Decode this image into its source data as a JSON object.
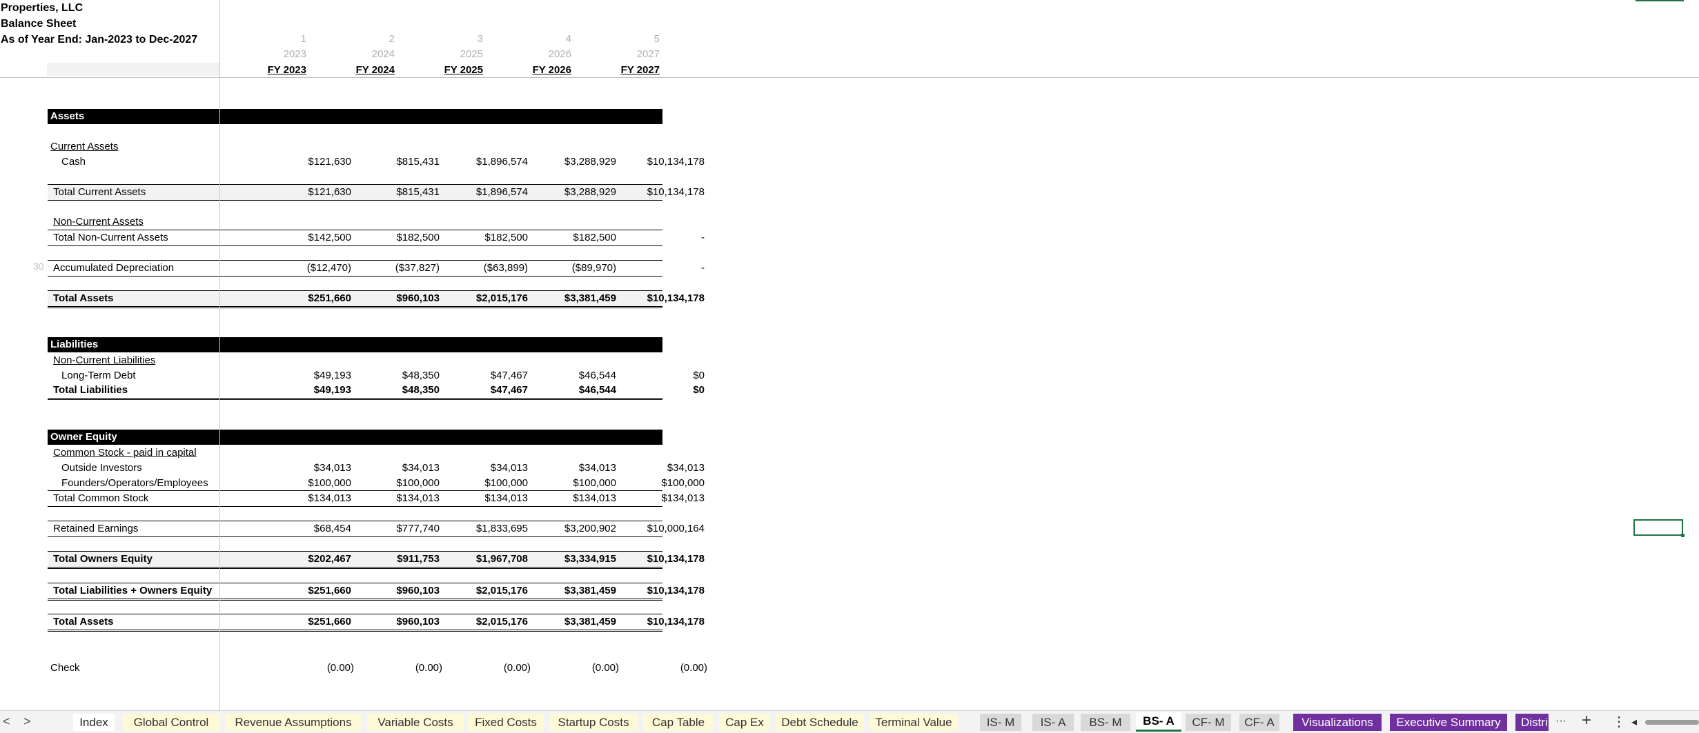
{
  "header": {
    "company": "Properties, LLC",
    "report": "Balance Sheet",
    "period": "As of Year End: Jan-2023 to Dec-2027"
  },
  "columns": [
    {
      "num": "1",
      "year": "2023",
      "fy": "FY 2023"
    },
    {
      "num": "2",
      "year": "2024",
      "fy": "FY 2024"
    },
    {
      "num": "3",
      "year": "2025",
      "fy": "FY 2025"
    },
    {
      "num": "4",
      "year": "2026",
      "fy": "FY 2026"
    },
    {
      "num": "5",
      "year": "2027",
      "fy": "FY 2027"
    }
  ],
  "sections": {
    "assets": "Assets",
    "liabilities": "Liabilities",
    "equity": "Owner Equity"
  },
  "rows": [
    {
      "label": "Current Assets",
      "values": []
    },
    {
      "label": "Cash",
      "values": [
        "$121,630",
        "$815,431",
        "$1,896,574",
        "$3,288,929",
        "$10,134,178"
      ]
    },
    {
      "label": "Total Current Assets",
      "values": [
        "$121,630",
        "$815,431",
        "$1,896,574",
        "$3,288,929",
        "$10,134,178"
      ]
    },
    {
      "label": "Non-Current Assets",
      "values": []
    },
    {
      "label": "Total Non-Current Assets",
      "values": [
        "$142,500",
        "$182,500",
        "$182,500",
        "$182,500",
        "-"
      ]
    },
    {
      "label": "Accumulated Depreciation",
      "values": [
        "($12,470)",
        "($37,827)",
        "($63,899)",
        "($89,970)",
        "-"
      ]
    },
    {
      "label": "Total Assets",
      "values": [
        "$251,660",
        "$960,103",
        "$2,015,176",
        "$3,381,459",
        "$10,134,178"
      ]
    },
    {
      "label": "Non-Current Liabilities",
      "values": []
    },
    {
      "label": "Long-Term Debt",
      "values": [
        "$49,193",
        "$48,350",
        "$47,467",
        "$46,544",
        "$0"
      ]
    },
    {
      "label": "Total Liabilities",
      "values": [
        "$49,193",
        "$48,350",
        "$47,467",
        "$46,544",
        "$0"
      ]
    },
    {
      "label": "Common Stock - paid in capital",
      "values": []
    },
    {
      "label": "Outside Investors",
      "values": [
        "$34,013",
        "$34,013",
        "$34,013",
        "$34,013",
        "$34,013"
      ]
    },
    {
      "label": "Founders/Operators/Employees",
      "values": [
        "$100,000",
        "$100,000",
        "$100,000",
        "$100,000",
        "$100,000"
      ]
    },
    {
      "label": "Total Common Stock",
      "values": [
        "$134,013",
        "$134,013",
        "$134,013",
        "$134,013",
        "$134,013"
      ]
    },
    {
      "label": "Retained Earnings",
      "values": [
        "$68,454",
        "$777,740",
        "$1,833,695",
        "$3,200,902",
        "$10,000,164"
      ]
    },
    {
      "label": "Total Owners Equity",
      "values": [
        "$202,467",
        "$911,753",
        "$1,967,708",
        "$3,334,915",
        "$10,134,178"
      ]
    },
    {
      "label": "Total Liabilities + Owners Equity",
      "values": [
        "$251,660",
        "$960,103",
        "$2,015,176",
        "$3,381,459",
        "$10,134,178"
      ]
    },
    {
      "label": "Total Assets",
      "values": [
        "$251,660",
        "$960,103",
        "$2,015,176",
        "$3,381,459",
        "$10,134,178"
      ]
    },
    {
      "label": "Check",
      "values": [
        "(0.00)",
        "(0.00)",
        "(0.00)",
        "(0.00)",
        "(0.00)"
      ]
    }
  ],
  "row_number_marker": "30",
  "tabs": [
    {
      "label": "Index",
      "style": "white"
    },
    {
      "label": "Global Control",
      "style": "yellow"
    },
    {
      "label": "Revenue Assumptions",
      "style": "yellow"
    },
    {
      "label": "Variable Costs",
      "style": "yellow"
    },
    {
      "label": "Fixed Costs",
      "style": "yellow"
    },
    {
      "label": "Startup Costs",
      "style": "yellow"
    },
    {
      "label": "Cap Table",
      "style": "yellow"
    },
    {
      "label": "Cap Ex",
      "style": "yellow"
    },
    {
      "label": "Debt Schedule",
      "style": "yellow"
    },
    {
      "label": "Terminal Value",
      "style": "yellow"
    },
    {
      "label": "IS- M",
      "style": "gray"
    },
    {
      "label": "IS- A",
      "style": "gray"
    },
    {
      "label": "BS- M",
      "style": "gray"
    },
    {
      "label": "BS- A",
      "style": "active"
    },
    {
      "label": "CF- M",
      "style": "gray"
    },
    {
      "label": "CF- A",
      "style": "gray"
    },
    {
      "label": "Visualizations",
      "style": "purple"
    },
    {
      "label": "Executive Summary",
      "style": "purple"
    },
    {
      "label": "Distri",
      "style": "purple"
    }
  ],
  "controls": {
    "prev": "<",
    "next": ">",
    "more": "···",
    "add": "+",
    "options": "⋮",
    "scroll_left": "◂"
  },
  "colors": {
    "section_header_bg": "#000000",
    "selection": "#217346",
    "tab_yellow": "#fef9d7",
    "tab_gray": "#d9d9d9",
    "tab_purple": "#7030a0"
  }
}
